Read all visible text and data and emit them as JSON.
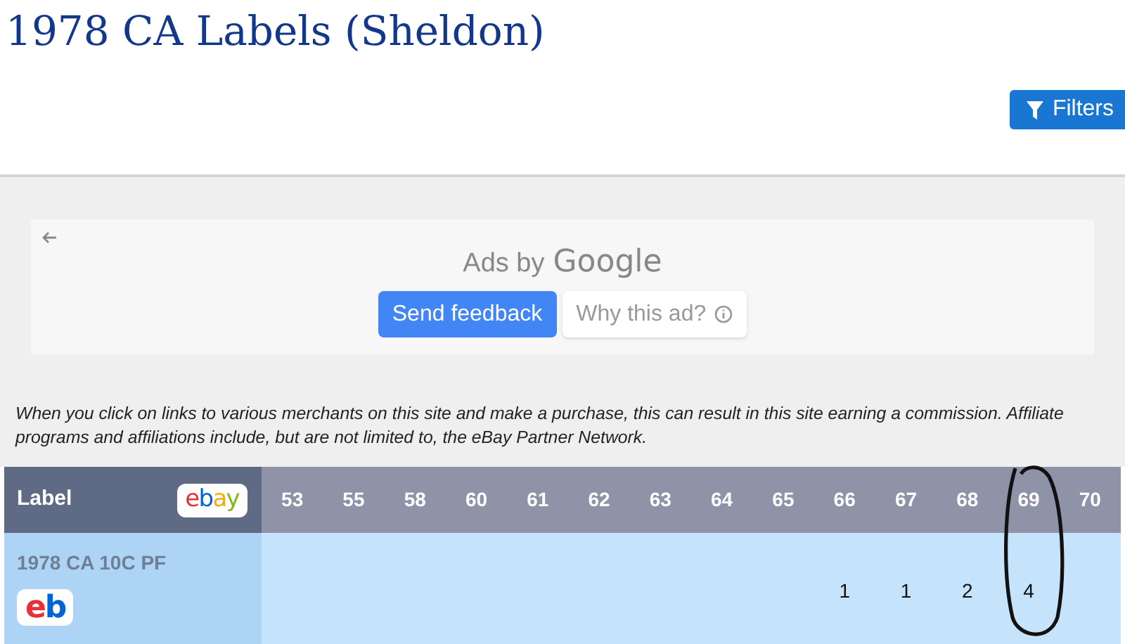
{
  "title": "1978 CA Labels (Sheldon)",
  "filters_button": "Filters",
  "ad": {
    "heading": "Ads by",
    "brand": "Google",
    "buttons": [
      {
        "label": "Send feedback",
        "kind": "primary"
      },
      {
        "label": "Why this ad?",
        "kind": "info"
      }
    ]
  },
  "disclaimer": "When you click on links to various merchants on this site and make a purchase, this can result in this site earning a commission. Affiliate programs and affiliations include, but are not limited to, the eBay Partner Network.",
  "table": {
    "label_column": {
      "label": "Label",
      "logo": "ebay"
    },
    "columns": [
      "53",
      "55",
      "58",
      "60",
      "61",
      "62",
      "63",
      "64",
      "65",
      "66",
      "67",
      "68",
      "69",
      "70"
    ],
    "rows": [
      {
        "label": "1978 CA 10C PF",
        "logo": "eb",
        "cells": [
          {
            "kind": "blank"
          },
          {
            "kind": "blank"
          },
          {
            "kind": "blank"
          },
          {
            "kind": "blank"
          },
          {
            "kind": "blank"
          },
          {
            "kind": "blank"
          },
          {
            "kind": "blank"
          },
          {
            "kind": "blank"
          },
          {
            "kind": "blank"
          },
          {
            "kind": "count",
            "value": "1"
          },
          {
            "kind": "count",
            "value": "1"
          },
          {
            "kind": "count",
            "value": "2"
          },
          {
            "kind": "count",
            "value": "4"
          },
          {
            "kind": "blank"
          }
        ]
      }
    ]
  }
}
